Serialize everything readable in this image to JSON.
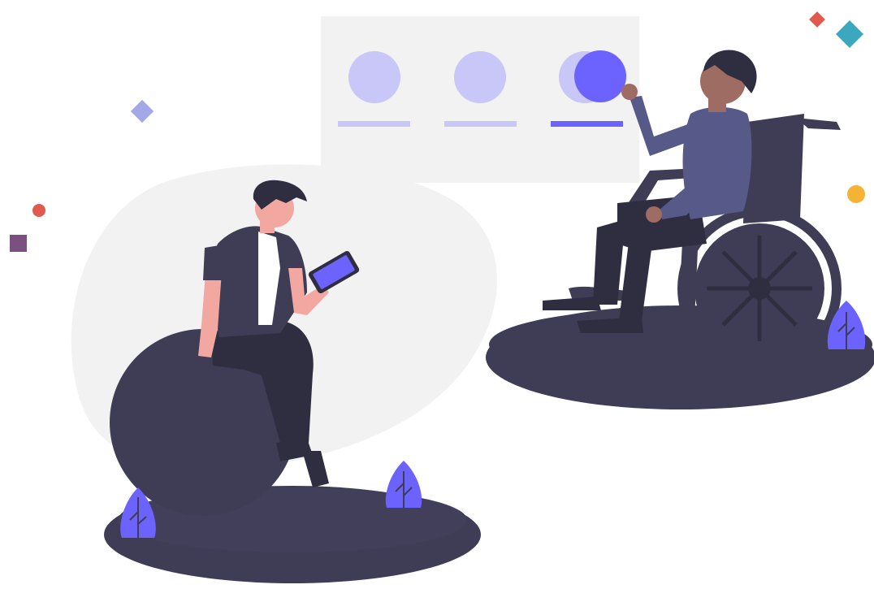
{
  "illustration": {
    "ui_panel": {
      "options": [
        {
          "icon": "option-circle-icon",
          "selected": false
        },
        {
          "icon": "option-circle-icon",
          "selected": false
        },
        {
          "icon": "option-circle-icon",
          "selected": true
        }
      ]
    },
    "figures": [
      "person-with-tablet",
      "person-in-wheelchair"
    ],
    "decorations": [
      "diamond-icon",
      "dot-icon",
      "square-icon",
      "leaf-icon"
    ]
  },
  "colors": {
    "accent": "#6c63ff",
    "accent_light": "#c9c6f8",
    "panel_bg": "#f2f2f2",
    "dark": "#3f3d56",
    "darker": "#2f2e41",
    "skin_light": "#f2a8a0",
    "skin_dark": "#9e6c63",
    "hair": "#2f2e41",
    "shirt_blue": "#575a89",
    "deco_red": "#e05a4f",
    "deco_teal": "#3ba8be",
    "deco_purple": "#7b4f7f",
    "deco_yellow": "#f5b335",
    "deco_lilac": "#a3a8e6"
  }
}
